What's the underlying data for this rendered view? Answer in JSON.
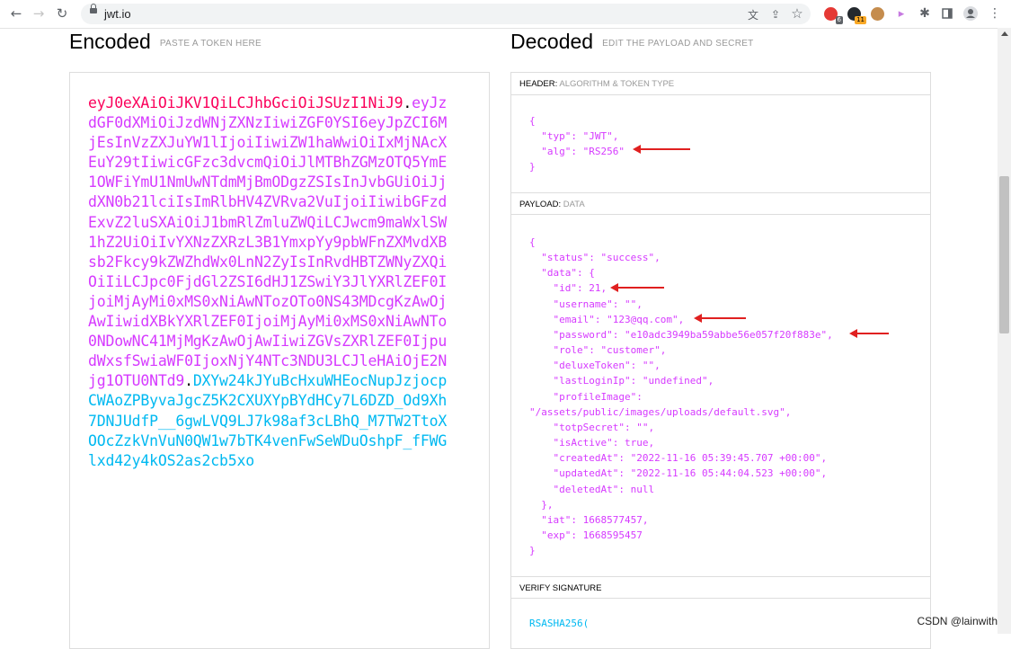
{
  "browser": {
    "url": "jwt.io",
    "extensions": [
      {
        "icon": "abp-icon",
        "badge": "6",
        "color": "#e53935",
        "badge_color": "#5f6368"
      },
      {
        "icon": "github-icon",
        "badge": "11",
        "color": "#24292e",
        "badge_color": "#f9a825"
      },
      {
        "icon": "owl-icon",
        "color": "#c58c4d"
      },
      {
        "icon": "pointer-icon",
        "color": "#c679e0"
      }
    ]
  },
  "encoded": {
    "title": "Encoded",
    "subtitle": "PASTE A TOKEN HERE",
    "token": {
      "header": "eyJ0eXAiOiJKV1QiLCJhbGciOiJSUzI1NiJ9",
      "payload": "eyJzdGF0dXMiOiJzdWNjZXNzIiwiZGF0YSI6eyJpZCI6MjEsInVzZXJuYW1lIjoiIiwiZW1haWwiOiIxMjNAcXEuY29tIiwicGFzc3dvcmQiOiJlMTBhZGMzOTQ5YmE1OWFiYmU1NmUwNTdmMjBmODgzZSIsInJvbGUiOiJjdXN0b21lciIsImRlbHV4ZVRva2VuIjoiIiwibGFzdExvZ2luSXAiOiJ1bmRlZmluZWQiLCJwcm9maWxlSW1hZ2UiOiIvYXNzZXRzL3B1YmxpYy9pbWFnZXMvdXBsb2Fkcy9kZWZhdWx0LnN2ZyIsInRvdHBTZWNyZXQiOiIiLCJpc0FjdGl2ZSI6dHJ1ZSwiY3JlYXRlZEF0IjoiMjAyMi0xMS0xNiAwNTozOTo0NS43MDcgKzAwOjAwIiwidXBkYXRlZEF0IjoiMjAyMi0xMS0xNiAwNTo0NDowNC41MjMgKzAwOjAwIiwiZGVsZXRlZEF0IjpudWxsfSwiaWF0IjoxNjY4NTc3NDU3LCJleHAiOjE2Njg1OTU0NTd9",
      "signature": "DXYw24kJYuBcHxuWHEocNupJzjocpCWAoZPByvaJgcZ5K2CXUXYpBYdHCy7L6DZD_Od9Xh7DNJUdfP__6gwLVQ9LJ7k98af3cLBhQ_M7TW2TtoXOOcZzkVnVuN0QW1w7bTK4venFwSeWDuOshpF_fFWGlxd42y4kOS2as2cb5xo"
    }
  },
  "decoded": {
    "title": "Decoded",
    "subtitle": "EDIT THE PAYLOAD AND SECRET",
    "header_label": "HEADER:",
    "header_sub": "ALGORITHM & TOKEN TYPE",
    "header_json": "{\n  \"typ\": \"JWT\",\n  \"alg\": \"RS256\"\n}",
    "payload_label": "PAYLOAD:",
    "payload_sub": "DATA",
    "payload_json": "{\n  \"status\": \"success\",\n  \"data\": {\n    \"id\": 21,\n    \"username\": \"\",\n    \"email\": \"123@qq.com\",\n    \"password\": \"e10adc3949ba59abbe56e057f20f883e\",\n    \"role\": \"customer\",\n    \"deluxeToken\": \"\",\n    \"lastLoginIp\": \"undefined\",\n    \"profileImage\":\n\"/assets/public/images/uploads/default.svg\",\n    \"totpSecret\": \"\",\n    \"isActive\": true,\n    \"createdAt\": \"2022-11-16 05:39:45.707 +00:00\",\n    \"updatedAt\": \"2022-11-16 05:44:04.523 +00:00\",\n    \"deletedAt\": null\n  },\n  \"iat\": 1668577457,\n  \"exp\": 1668595457\n}",
    "verify_label": "VERIFY SIGNATURE",
    "verify_code": "RSASHA256("
  },
  "annotations": {
    "arrow_color": "#e02020"
  },
  "watermark": "CSDN @lainwith"
}
